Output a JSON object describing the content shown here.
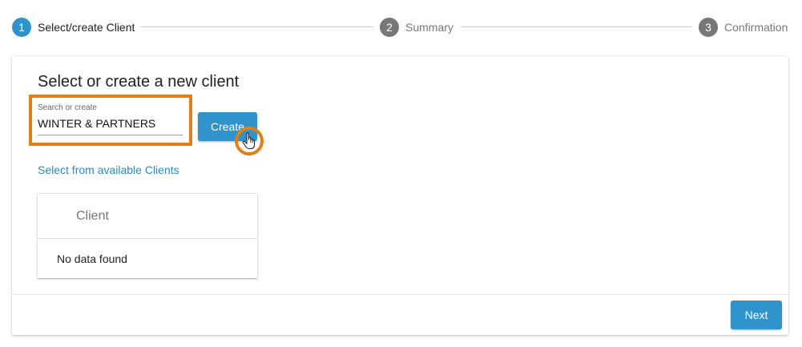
{
  "colors": {
    "accent": "#2f94cc",
    "inactive_step": "#777777",
    "highlight": "#e37f14",
    "link": "#2a88c2"
  },
  "stepper": {
    "steps": [
      {
        "number": "1",
        "label": "Select/create Client",
        "state": "active"
      },
      {
        "number": "2",
        "label": "Summary",
        "state": "inactive"
      },
      {
        "number": "3",
        "label": "Confirmation",
        "state": "inactive"
      }
    ]
  },
  "card": {
    "title": "Select or create a new client",
    "search": {
      "label": "Search or create",
      "value": "WINTER & PARTNERS"
    },
    "create_label": "Create",
    "cursor_icon": "hand-pointer-icon",
    "select_link": "Select from available Clients",
    "table": {
      "column_header": "Client",
      "empty_message": "No data found"
    },
    "next_label": "Next"
  }
}
